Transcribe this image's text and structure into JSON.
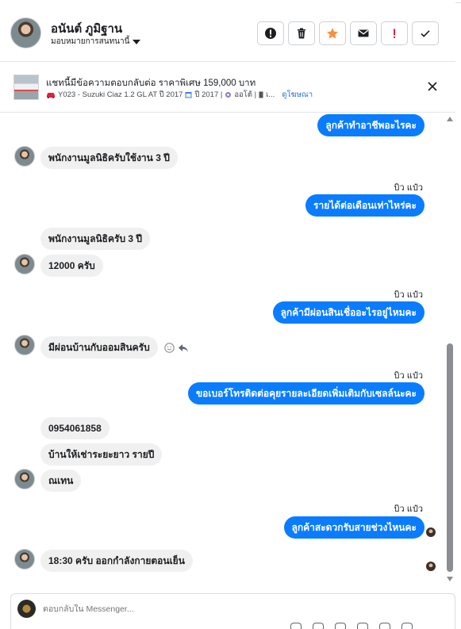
{
  "header": {
    "contact_name": "อนันต์ ภูมิฐาน",
    "assign_label": "มอบหมายการสนทนานี้",
    "actions": [
      {
        "name": "spam-button",
        "icon": "alert-circle-icon"
      },
      {
        "name": "delete-button",
        "icon": "trash-icon"
      },
      {
        "name": "star-button",
        "icon": "star-icon"
      },
      {
        "name": "mark-unread-button",
        "icon": "envelope-icon"
      },
      {
        "name": "flag-button",
        "icon": "exclamation-icon"
      },
      {
        "name": "done-button",
        "icon": "check-icon"
      }
    ],
    "colors": {
      "star": "#f5923e",
      "flag": "#e41e3f"
    }
  },
  "listing": {
    "title": "แชทนี้มีข้อความตอบกลับต่อ ราคาพิเศษ 159,000 บาท",
    "model": "Y023 - Suzuki Ciaz 1.2 GL AT ปี 2017",
    "year": "ปี 2017 |",
    "transmission": "ออโต้ |",
    "extra": "เ...",
    "link": "ดูโฆษณา"
  },
  "messages": {
    "m1": "ลูกค้าทำอาชีพอะไรคะ",
    "m2": "พนักงานมูลนิธิครับใช้งาน 3 ปี",
    "sender_a": "บิว แป๋ว",
    "m3": "รายได้ต่อเดือนเท่าไหร่คะ",
    "m4": "พนักงานมูลนิธิครับ 3 ปี",
    "m5": "12000 ครับ",
    "sender_b": "บิว แป๋ว",
    "m6": "ลูกค้ามีผ่อนสินเชื่ออะไรอยู่ไหมคะ",
    "m7": "มีผ่อนบ้านกับออมสินครับ",
    "sender_c": "บิว แป๋ว",
    "m8": "ขอเบอร์โทรติดต่อคุยรายละเอียดเพิ่มเติมกับเซลล์นะคะ",
    "m9": "0954061858",
    "m10": "บ้านให้เช่าระยะยาว รายปี",
    "m11": "ณเทน",
    "sender_d": "บิว แป๋ว",
    "m12": "ลูกค้าสะดวกรับสายช่วงไหนคะ",
    "m13": "18:30 ครับ ออกกำลังกายตอนเย็น"
  },
  "composer": {
    "placeholder": "ตอบกลับใน Messenger..."
  },
  "colors": {
    "outgoing_bubble": "#0a7cff",
    "incoming_bubble": "#f0f0f0",
    "link": "#216fdb"
  }
}
